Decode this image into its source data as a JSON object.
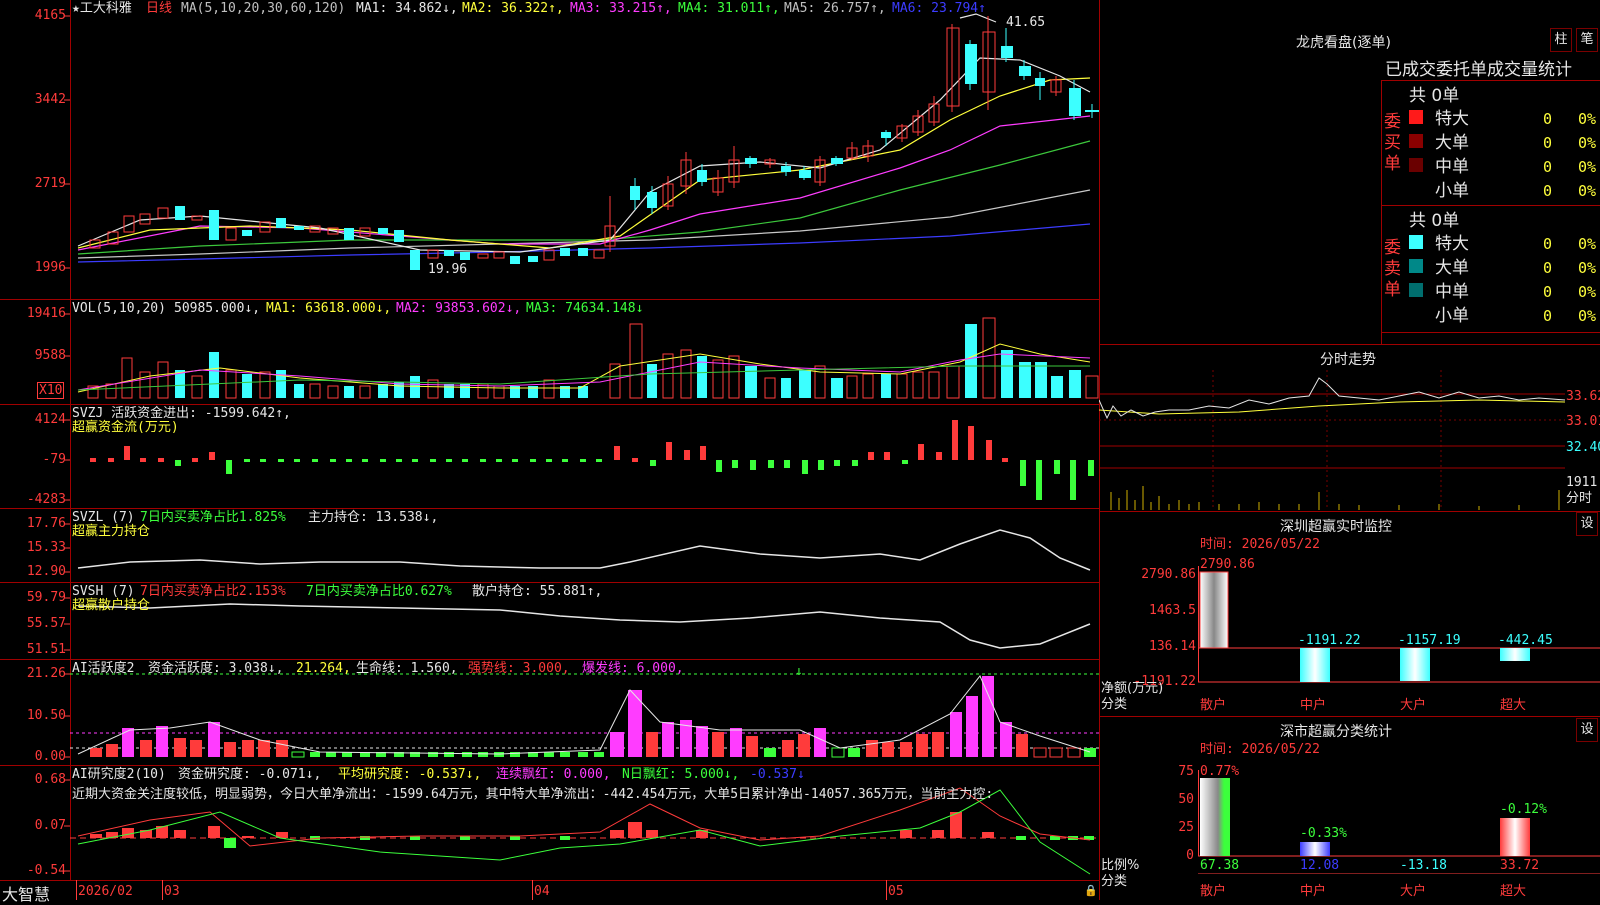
{
  "kline": {
    "title": "★工大科雅",
    "period": "日线",
    "ma_label": "MA(5,10,20,30,60,120)",
    "ma1": "MA1: 34.862↓,",
    "ma2": "MA2: 36.322↑,",
    "ma3": "MA3: 33.215↑,",
    "ma4": "MA4: 31.011↑,",
    "ma5": "MA5: 26.757↑,",
    "ma6": "MA6: 23.794↑",
    "axis": [
      "4165",
      "3442",
      "2719",
      "1996"
    ],
    "high_label": "41.65",
    "low_label": "19.96"
  },
  "vol": {
    "label": "VOL(5,10,20)",
    "value": "50985.000↓,",
    "ma1": "MA1: 63618.000↓,",
    "ma2": "MA2: 93853.602↓,",
    "ma3": "MA3: 74634.148↓",
    "axis": [
      "19416",
      "9588"
    ],
    "unit": "X10"
  },
  "svzj": {
    "label": "SVZJ  活跃资金进出: -1599.642↑,",
    "sub": "超赢资金流(万元)",
    "axis": [
      "4124",
      "-79",
      "-4283"
    ]
  },
  "svzl": {
    "label": "SVZL (7)",
    "pct": "7日内买卖净占比1.825%",
    "hold": "主力持仓: 13.538↓,",
    "sub": "超赢主力持仓",
    "axis": [
      "17.76",
      "15.33",
      "12.90"
    ]
  },
  "svsh": {
    "label": "SVSH (7)",
    "pct1": "7日内买卖净占比2.153%",
    "pct2": "7日内买卖净占比0.627%",
    "hold": "散户持仓: 55.881↑,",
    "sub": "超赢散户持仓",
    "axis": [
      "59.79",
      "55.57",
      "51.51"
    ]
  },
  "ai_active": {
    "label": "AI活跃度2",
    "a": "资金活跃度: 3.038↓,",
    "b": "21.264,",
    "c": "生命线: 1.560,",
    "d": "强势线: 3.000,",
    "e": "爆发线: 6.000,",
    "axis": [
      "21.26",
      "10.50",
      "0.00"
    ]
  },
  "ai_research": {
    "label": "AI研究度2(10)",
    "a": "资金研究度: -0.071↓,",
    "b": "平均研究度: -0.537↓,",
    "c": "连续飘红: 0.000,",
    "d": "N日飘红: 5.000↓,",
    "e": "-0.537↓",
    "comment": "近期大资金关注度较低，明显弱势，今日大单净流出：-1599.64万元，其中特大单净流出：-442.454万元，大单5日累计净出-14057.365万元，当前主力控:",
    "axis": [
      "0.68",
      "0.07",
      "-0.54"
    ]
  },
  "footer": {
    "brand": "大智慧",
    "date1": "2026/02",
    "m03": "03",
    "m04": "04",
    "m05": "05"
  },
  "lhb": {
    "title": "龙虎看盘(逐单)",
    "btn1": "柱",
    "btn2": "笔",
    "header": "已成交委托单成交量统计",
    "buy_label": "委买单",
    "sell_label": "委卖单",
    "buy_total": "共 0单",
    "sell_total": "共 0单",
    "rows": [
      {
        "name": "特大",
        "count": "0",
        "pct": "0%"
      },
      {
        "name": "大单",
        "count": "0",
        "pct": "0%"
      },
      {
        "name": "中单",
        "count": "0",
        "pct": "0%"
      },
      {
        "name": "小单",
        "count": "0",
        "pct": "0%"
      }
    ]
  },
  "intraday": {
    "title": "分时走势",
    "p1": "33.62",
    "p2": "33.01",
    "p3": "32.40",
    "vol": "1911",
    "label": "分时"
  },
  "monitor": {
    "title": "深圳超赢实时监控",
    "btn": "设",
    "time": "时间: 2026/05/22",
    "axis": [
      "2790.86",
      "1463.5",
      "136.14",
      "-1191.22"
    ],
    "values": [
      "2790.86",
      "-1191.22",
      "-1157.19",
      "-442.45"
    ],
    "unit1": "净额(万元)",
    "unit2": "分类",
    "cats": [
      "散户",
      "中户",
      "大户",
      "超大"
    ]
  },
  "classify": {
    "title": "深市超赢分类统计",
    "btn": "设",
    "time": "时间: 2026/05/22",
    "axis": [
      "75",
      "50",
      "25",
      "0"
    ],
    "top_labels": [
      "0.77%",
      "-0.33%",
      "",
      "-0.12%"
    ],
    "bottom_values": [
      "67.38",
      "12.08",
      "-13.18",
      "33.72"
    ],
    "unit1": "比例%",
    "unit2": "分类",
    "cats": [
      "散户",
      "中户",
      "大户",
      "超大"
    ]
  },
  "colors": {
    "up": "#ff3b3b",
    "down": "#3cffff",
    "frame": "#a00000"
  }
}
